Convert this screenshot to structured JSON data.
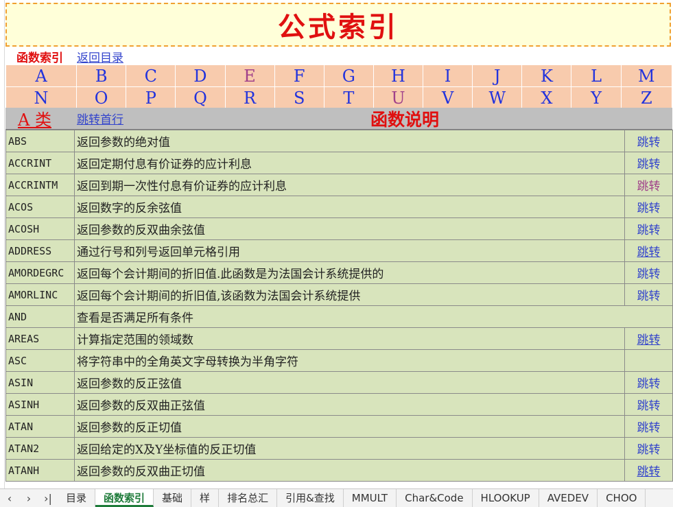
{
  "title": "公式索引",
  "header": {
    "current_label": "函数索引",
    "back_link": "返回目录"
  },
  "letters": {
    "row1": [
      "A",
      "B",
      "C",
      "D",
      "E",
      "F",
      "G",
      "H",
      "I",
      "J",
      "K",
      "L",
      "M"
    ],
    "row2": [
      "N",
      "O",
      "P",
      "Q",
      "R",
      "S",
      "T",
      "U",
      "V",
      "W",
      "X",
      "Y",
      "Z"
    ]
  },
  "letter_colors": {
    "E": "#a0408a",
    "U": "#a0408a",
    "default": "#2233dd"
  },
  "category": {
    "label": "A 类",
    "jump_top": "跳转首行",
    "desc_header": "函数说明"
  },
  "functions": [
    {
      "name": "ABS",
      "desc": "返回参数的绝对值",
      "jump": "跳转",
      "style": ""
    },
    {
      "name": "ACCRINT",
      "desc": "返回定期付息有价证券的应计利息",
      "jump": "跳转",
      "style": ""
    },
    {
      "name": "ACCRINTM",
      "desc": "返回到期一次性付息有价证券的应计利息",
      "jump": "跳转",
      "style": "purple"
    },
    {
      "name": "ACOS",
      "desc": "返回数字的反余弦值",
      "jump": "跳转",
      "style": ""
    },
    {
      "name": "ACOSH",
      "desc": "返回参数的反双曲余弦值",
      "jump": "跳转",
      "style": ""
    },
    {
      "name": "ADDRESS",
      "desc": "通过行号和列号返回单元格引用",
      "jump": "跳转",
      "style": "ul"
    },
    {
      "name": "AMORDEGRC",
      "desc": "返回每个会计期间的折旧值.此函数是为法国会计系统提供的",
      "jump": "跳转",
      "style": ""
    },
    {
      "name": "AMORLINC",
      "desc": "返回每个会计期间的折旧值,该函数为法国会计系统提供",
      "jump": "跳转",
      "style": ""
    },
    {
      "name": "AND",
      "desc": "查看是否满足所有条件",
      "jump": "",
      "style": "merged"
    },
    {
      "name": "AREAS",
      "desc": "计算指定范围的领域数",
      "jump": "跳转",
      "style": "ul"
    },
    {
      "name": "ASC",
      "desc": "将字符串中的全角英文字母转换为半角字符",
      "jump": "",
      "style": ""
    },
    {
      "name": "ASIN",
      "desc": "返回参数的反正弦值",
      "jump": "跳转",
      "style": ""
    },
    {
      "name": "ASINH",
      "desc": "返回参数的反双曲正弦值",
      "jump": "跳转",
      "style": ""
    },
    {
      "name": "ATAN",
      "desc": "返回参数的反正切值",
      "jump": "跳转",
      "style": ""
    },
    {
      "name": "ATAN2",
      "desc": "返回给定的X及Y坐标值的反正切值",
      "jump": "跳转",
      "style": ""
    },
    {
      "name": "ATANH",
      "desc": "返回参数的反双曲正切值",
      "jump": "跳转",
      "style": "ul"
    }
  ],
  "tabs": {
    "nav": [
      "‹",
      "›",
      "›|"
    ],
    "items": [
      "目录",
      "函数索引",
      "基础",
      "样",
      "排名总汇",
      "引用&查找",
      "MMULT",
      "Char&Code",
      "HLOOKUP",
      "AVEDEV",
      "CHOO"
    ],
    "active": "函数索引"
  }
}
